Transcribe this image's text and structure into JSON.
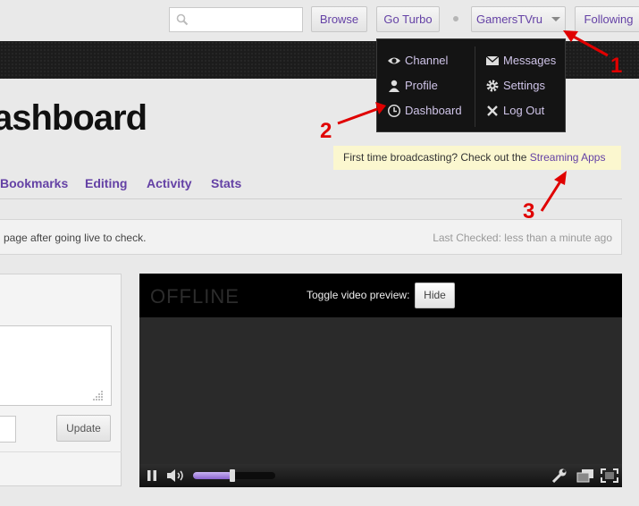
{
  "topnav": {
    "search_placeholder": "",
    "browse": "Browse",
    "go_turbo": "Go Turbo",
    "user": "GamersTVru",
    "following": "Following"
  },
  "menu": {
    "channel": "Channel",
    "messages": "Messages",
    "profile": "Profile",
    "settings": "Settings",
    "dashboard": "Dashboard",
    "logout": "Log Out"
  },
  "page": {
    "title_fragment": "ashboard",
    "tip_prefix": "First time broadcasting? Check out the ",
    "tip_link": "Streaming Apps",
    "tabs": [
      "Bookmarks",
      "Editing",
      "Activity",
      "Stats"
    ],
    "status_message": "page after going live to check.",
    "last_checked": "Last Checked: less than a minute ago",
    "update": "Update"
  },
  "player": {
    "offline": "OFFLINE",
    "toggle_label": "Toggle video preview:",
    "hide": "Hide",
    "volume_fraction": 0.48
  },
  "annotations": [
    "1",
    "2",
    "3"
  ],
  "colors": {
    "accent": "#6441a5",
    "annotation": "#e00000",
    "tip_bg": "#fbf7cf"
  },
  "icons": [
    "search-icon",
    "caret-down-icon",
    "eye-icon",
    "envelope-icon",
    "user-icon",
    "gear-icon",
    "clock-icon",
    "close-icon",
    "pause-icon",
    "speaker-icon",
    "wrench-icon",
    "popout-icon",
    "fullscreen-icon"
  ]
}
